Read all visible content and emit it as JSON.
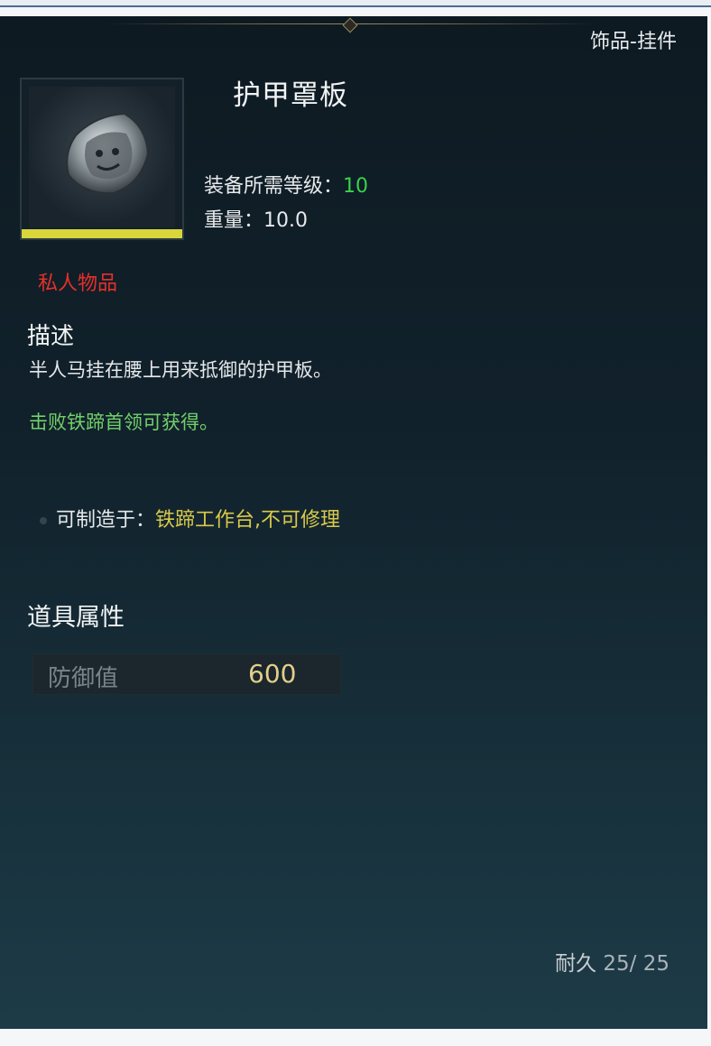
{
  "category": "饰品-挂件",
  "item": {
    "name": "护甲罩板",
    "icon": "armor-plate-icon",
    "rarity_color": "#d8d63a",
    "level_label": "装备所需等级：",
    "level_value": "10",
    "weight_label": "重量：",
    "weight_value": "10.0",
    "private_label": "私人物品"
  },
  "description": {
    "heading": "描述",
    "text": "半人马挂在腰上用来抵御的护甲板。",
    "obtain": "击败铁蹄首领可获得。"
  },
  "craft": {
    "label": "可制造于：",
    "value": "铁蹄工作台,不可修理"
  },
  "attributes": {
    "heading": "道具属性",
    "rows": [
      {
        "name": "防御值",
        "value": "600"
      }
    ]
  },
  "durability": {
    "label": "耐久",
    "current": "25/",
    "max": "25"
  }
}
